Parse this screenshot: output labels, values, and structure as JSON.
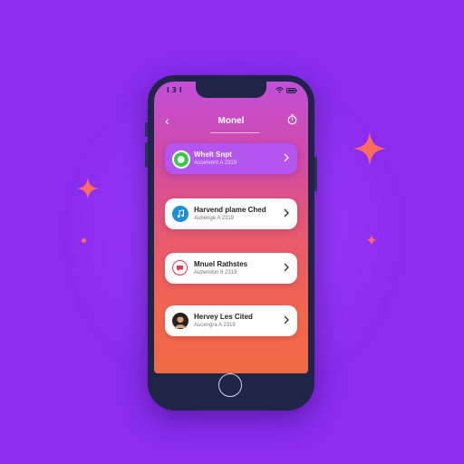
{
  "status_bar": {
    "time": "l 3 l"
  },
  "nav": {
    "title": "Monel"
  },
  "cards": [
    {
      "title": "Whelt Snpt",
      "subtitle": "Aucervent A 2319",
      "icon": "whatsapp-icon",
      "highlighted": true
    },
    {
      "title": "Harvend plame Ched",
      "subtitle": "Aubenge A 2319",
      "icon": "music-note-icon",
      "highlighted": false
    },
    {
      "title": "Mnuel Rathstes",
      "subtitle": "Aubendon 6 2319",
      "icon": "chat-bubble-icon",
      "highlighted": false
    },
    {
      "title": "Hervey Les Cited",
      "subtitle": "Aucengra A 2319",
      "icon": "avatar-icon",
      "highlighted": false
    }
  ],
  "colors": {
    "background": "#8a2df0",
    "phone_body": "#1f2547",
    "highlight_card": "#b455f0",
    "accent_orange": "#f2664d"
  }
}
